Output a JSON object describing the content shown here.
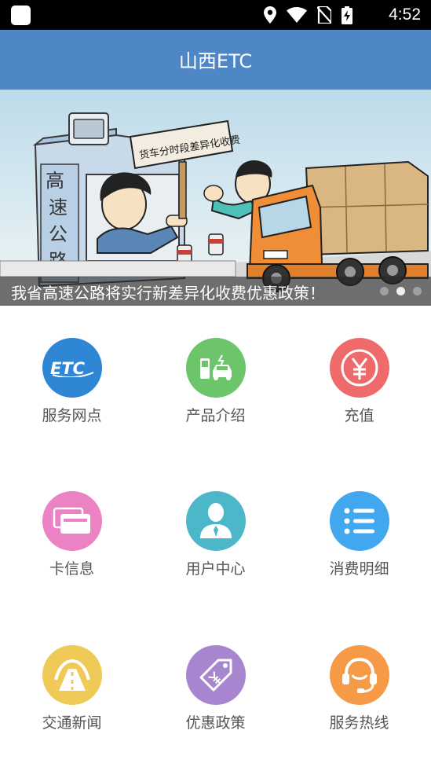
{
  "status_bar": {
    "time": "4:52",
    "icons": [
      "location-icon",
      "wifi-icon",
      "no-sim-icon",
      "battery-charging-icon"
    ]
  },
  "app_bar": {
    "title": "山西ETC"
  },
  "banner": {
    "sign_text": "货车分时段差异化收费",
    "tollbooth_text": "高速公路",
    "caption": "我省高速公路将实行新差异化收费优惠政策！",
    "slide_count": 3,
    "active_slide": 2
  },
  "grid": {
    "items": [
      {
        "label": "服务网点",
        "icon": "etc-icon",
        "color": "#2f86d4"
      },
      {
        "label": "产品介绍",
        "icon": "car-charging-icon",
        "color": "#6cc46b"
      },
      {
        "label": "充值",
        "icon": "yuan-icon",
        "color": "#ef6b6b"
      },
      {
        "label": "卡信息",
        "icon": "card-icon",
        "color": "#ea82c4"
      },
      {
        "label": "用户中心",
        "icon": "user-icon",
        "color": "#4bb7c8"
      },
      {
        "label": "消费明细",
        "icon": "list-icon",
        "color": "#41a8ef"
      },
      {
        "label": "交通新闻",
        "icon": "road-icon",
        "color": "#f0ca56"
      },
      {
        "label": "优惠政策",
        "icon": "tag-icon",
        "color": "#a786cf"
      },
      {
        "label": "服务热线",
        "icon": "headset-icon",
        "color": "#f79a48"
      }
    ]
  }
}
